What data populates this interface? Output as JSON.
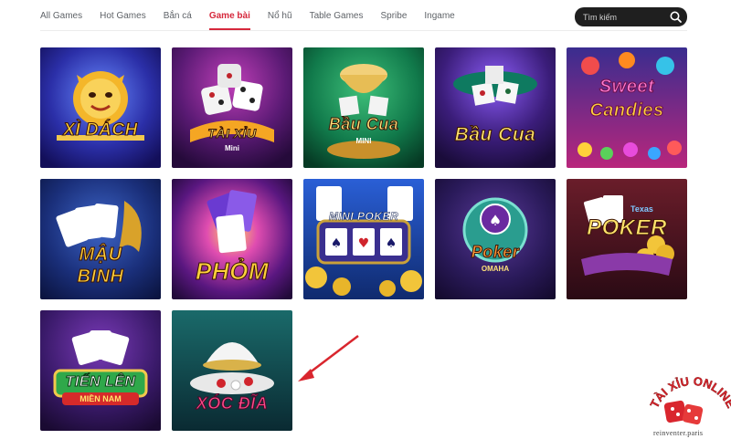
{
  "tabs": [
    {
      "label": "All Games",
      "active": false
    },
    {
      "label": "Hot Games",
      "active": false
    },
    {
      "label": "Bắn cá",
      "active": false
    },
    {
      "label": "Game bài",
      "active": true
    },
    {
      "label": "Nổ hũ",
      "active": false
    },
    {
      "label": "Table Games",
      "active": false
    },
    {
      "label": "Spribe",
      "active": false
    },
    {
      "label": "Ingame",
      "active": false
    }
  ],
  "search": {
    "placeholder": "Tìm kiếm",
    "icon": "search-icon"
  },
  "games": [
    {
      "title": "XÌ DÁCH",
      "subtitle": ""
    },
    {
      "title": "TÀI XỈU",
      "subtitle": "Mini"
    },
    {
      "title": "Bầu Cua",
      "subtitle": "MINI"
    },
    {
      "title": "Bầu Cua",
      "subtitle": ""
    },
    {
      "title": "Sweet",
      "subtitle": "Candies"
    },
    {
      "title": "MẬU",
      "subtitle": "BINH"
    },
    {
      "title": "PHỎM",
      "subtitle": ""
    },
    {
      "title": "MINI POKER",
      "subtitle": ""
    },
    {
      "title": "Poker",
      "subtitle": "OMAHA"
    },
    {
      "title": "POKER",
      "subtitle": "Texas"
    },
    {
      "title": "TIẾN LÊN",
      "subtitle": "MIỀN NAM"
    },
    {
      "title": "XÓC ĐĨA",
      "subtitle": ""
    }
  ],
  "watermark": {
    "brand": "TÀI XỈU ONLINE",
    "url": "reinventer.paris"
  },
  "colors": {
    "accent": "#d6283c",
    "arrow": "#d9262e",
    "search_bg": "#1f1f1f"
  }
}
